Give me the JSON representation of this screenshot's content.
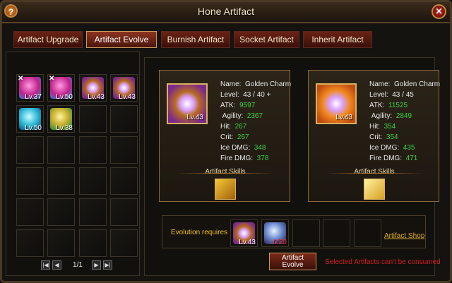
{
  "window": {
    "title": "Hone Artifact",
    "help_label": "?",
    "close_label": "✕"
  },
  "tabs": [
    "Artifact Upgrade",
    "Artifact Evolve",
    "Burnish Artifact",
    "Socket Artifact",
    "Inherit Artifact"
  ],
  "active_tab": "Artifact Evolve",
  "inventory": {
    "items": [
      {
        "lv": "Lv.37",
        "icon": "pink-gem-icon",
        "locked": true
      },
      {
        "lv": "Lv.50",
        "icon": "pink-gem-icon",
        "locked": true
      },
      {
        "lv": "Lv.43",
        "icon": "golden-charm-icon",
        "locked": false
      },
      {
        "lv": "Lv.43",
        "icon": "golden-charm-icon",
        "locked": false
      },
      {
        "lv": "Lv.50",
        "icon": "cyan-gem-icon",
        "locked": false
      },
      {
        "lv": "Lv.38",
        "icon": "green-gem-icon",
        "locked": false
      }
    ],
    "lock_mark": "✕",
    "pager": {
      "label": "1/1",
      "first": "|◀",
      "prev": "◀",
      "next": "▶",
      "last": "▶|"
    }
  },
  "current": {
    "icon_lv": "Lv.43",
    "name_label": "Name:",
    "name": "Golden Charm",
    "level_label": "Level:",
    "level": "43 / 40 +",
    "stats": [
      {
        "label": "ATK:",
        "value": "9597"
      },
      {
        "label": "Agility:",
        "value": "2367"
      },
      {
        "label": "Hit:",
        "value": "267"
      },
      {
        "label": "Crit:",
        "value": "267"
      },
      {
        "label": "Ice DMG:",
        "value": "348"
      },
      {
        "label": "Fire DMG:",
        "value": "378"
      }
    ],
    "skills_title": "Artifact Skills"
  },
  "result": {
    "icon_lv": "Lv.43",
    "name_label": "Name:",
    "name": "Golden Charm",
    "level_label": "Level:",
    "level": "43 / 45",
    "stats": [
      {
        "label": "ATK:",
        "value": "11525"
      },
      {
        "label": "Agility:",
        "value": "2849"
      },
      {
        "label": "Hit:",
        "value": "354"
      },
      {
        "label": "Crit:",
        "value": "354"
      },
      {
        "label": "Ice DMG:",
        "value": "435"
      },
      {
        "label": "Fire DMG:",
        "value": "471"
      }
    ],
    "skills_title": "Artifact Skills"
  },
  "evolution": {
    "label": "Evolution requires",
    "req1_lv": "Lv.43",
    "req2_count": "0/20",
    "shop_link": "Artifact Shop"
  },
  "evolve_button": {
    "line1": "Artifact",
    "line2": "Evolve"
  },
  "warning": "Selected Artifacts can't be consumed"
}
